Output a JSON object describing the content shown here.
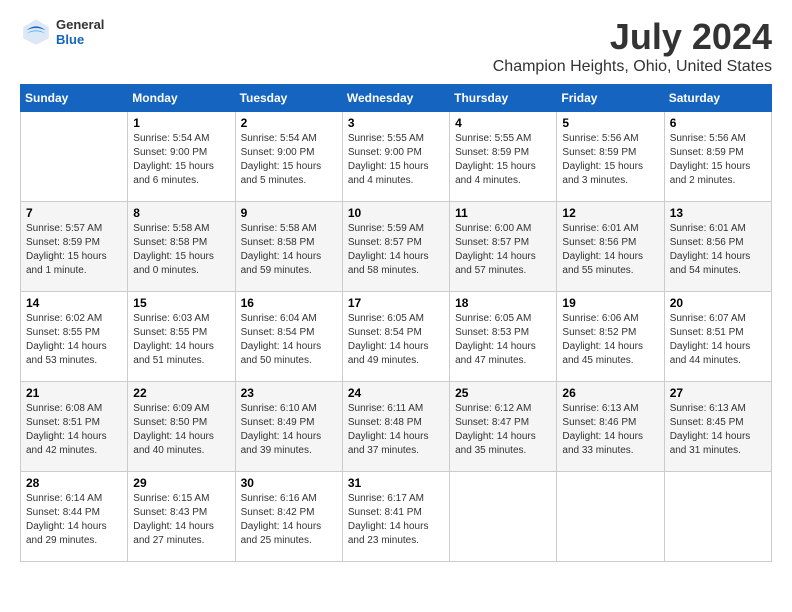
{
  "header": {
    "logo": {
      "line1": "General",
      "line2": "Blue"
    },
    "title": "July 2024",
    "subtitle": "Champion Heights, Ohio, United States"
  },
  "calendar": {
    "days_of_week": [
      "Sunday",
      "Monday",
      "Tuesday",
      "Wednesday",
      "Thursday",
      "Friday",
      "Saturday"
    ],
    "weeks": [
      [
        {
          "day": "",
          "sunrise": "",
          "sunset": "",
          "daylight": "",
          "empty": true
        },
        {
          "day": "1",
          "sunrise": "Sunrise: 5:54 AM",
          "sunset": "Sunset: 9:00 PM",
          "daylight": "Daylight: 15 hours and 6 minutes.",
          "empty": false
        },
        {
          "day": "2",
          "sunrise": "Sunrise: 5:54 AM",
          "sunset": "Sunset: 9:00 PM",
          "daylight": "Daylight: 15 hours and 5 minutes.",
          "empty": false
        },
        {
          "day": "3",
          "sunrise": "Sunrise: 5:55 AM",
          "sunset": "Sunset: 9:00 PM",
          "daylight": "Daylight: 15 hours and 4 minutes.",
          "empty": false
        },
        {
          "day": "4",
          "sunrise": "Sunrise: 5:55 AM",
          "sunset": "Sunset: 8:59 PM",
          "daylight": "Daylight: 15 hours and 4 minutes.",
          "empty": false
        },
        {
          "day": "5",
          "sunrise": "Sunrise: 5:56 AM",
          "sunset": "Sunset: 8:59 PM",
          "daylight": "Daylight: 15 hours and 3 minutes.",
          "empty": false
        },
        {
          "day": "6",
          "sunrise": "Sunrise: 5:56 AM",
          "sunset": "Sunset: 8:59 PM",
          "daylight": "Daylight: 15 hours and 2 minutes.",
          "empty": false
        }
      ],
      [
        {
          "day": "7",
          "sunrise": "Sunrise: 5:57 AM",
          "sunset": "Sunset: 8:59 PM",
          "daylight": "Daylight: 15 hours and 1 minute.",
          "empty": false
        },
        {
          "day": "8",
          "sunrise": "Sunrise: 5:58 AM",
          "sunset": "Sunset: 8:58 PM",
          "daylight": "Daylight: 15 hours and 0 minutes.",
          "empty": false
        },
        {
          "day": "9",
          "sunrise": "Sunrise: 5:58 AM",
          "sunset": "Sunset: 8:58 PM",
          "daylight": "Daylight: 14 hours and 59 minutes.",
          "empty": false
        },
        {
          "day": "10",
          "sunrise": "Sunrise: 5:59 AM",
          "sunset": "Sunset: 8:57 PM",
          "daylight": "Daylight: 14 hours and 58 minutes.",
          "empty": false
        },
        {
          "day": "11",
          "sunrise": "Sunrise: 6:00 AM",
          "sunset": "Sunset: 8:57 PM",
          "daylight": "Daylight: 14 hours and 57 minutes.",
          "empty": false
        },
        {
          "day": "12",
          "sunrise": "Sunrise: 6:01 AM",
          "sunset": "Sunset: 8:56 PM",
          "daylight": "Daylight: 14 hours and 55 minutes.",
          "empty": false
        },
        {
          "day": "13",
          "sunrise": "Sunrise: 6:01 AM",
          "sunset": "Sunset: 8:56 PM",
          "daylight": "Daylight: 14 hours and 54 minutes.",
          "empty": false
        }
      ],
      [
        {
          "day": "14",
          "sunrise": "Sunrise: 6:02 AM",
          "sunset": "Sunset: 8:55 PM",
          "daylight": "Daylight: 14 hours and 53 minutes.",
          "empty": false
        },
        {
          "day": "15",
          "sunrise": "Sunrise: 6:03 AM",
          "sunset": "Sunset: 8:55 PM",
          "daylight": "Daylight: 14 hours and 51 minutes.",
          "empty": false
        },
        {
          "day": "16",
          "sunrise": "Sunrise: 6:04 AM",
          "sunset": "Sunset: 8:54 PM",
          "daylight": "Daylight: 14 hours and 50 minutes.",
          "empty": false
        },
        {
          "day": "17",
          "sunrise": "Sunrise: 6:05 AM",
          "sunset": "Sunset: 8:54 PM",
          "daylight": "Daylight: 14 hours and 49 minutes.",
          "empty": false
        },
        {
          "day": "18",
          "sunrise": "Sunrise: 6:05 AM",
          "sunset": "Sunset: 8:53 PM",
          "daylight": "Daylight: 14 hours and 47 minutes.",
          "empty": false
        },
        {
          "day": "19",
          "sunrise": "Sunrise: 6:06 AM",
          "sunset": "Sunset: 8:52 PM",
          "daylight": "Daylight: 14 hours and 45 minutes.",
          "empty": false
        },
        {
          "day": "20",
          "sunrise": "Sunrise: 6:07 AM",
          "sunset": "Sunset: 8:51 PM",
          "daylight": "Daylight: 14 hours and 44 minutes.",
          "empty": false
        }
      ],
      [
        {
          "day": "21",
          "sunrise": "Sunrise: 6:08 AM",
          "sunset": "Sunset: 8:51 PM",
          "daylight": "Daylight: 14 hours and 42 minutes.",
          "empty": false
        },
        {
          "day": "22",
          "sunrise": "Sunrise: 6:09 AM",
          "sunset": "Sunset: 8:50 PM",
          "daylight": "Daylight: 14 hours and 40 minutes.",
          "empty": false
        },
        {
          "day": "23",
          "sunrise": "Sunrise: 6:10 AM",
          "sunset": "Sunset: 8:49 PM",
          "daylight": "Daylight: 14 hours and 39 minutes.",
          "empty": false
        },
        {
          "day": "24",
          "sunrise": "Sunrise: 6:11 AM",
          "sunset": "Sunset: 8:48 PM",
          "daylight": "Daylight: 14 hours and 37 minutes.",
          "empty": false
        },
        {
          "day": "25",
          "sunrise": "Sunrise: 6:12 AM",
          "sunset": "Sunset: 8:47 PM",
          "daylight": "Daylight: 14 hours and 35 minutes.",
          "empty": false
        },
        {
          "day": "26",
          "sunrise": "Sunrise: 6:13 AM",
          "sunset": "Sunset: 8:46 PM",
          "daylight": "Daylight: 14 hours and 33 minutes.",
          "empty": false
        },
        {
          "day": "27",
          "sunrise": "Sunrise: 6:13 AM",
          "sunset": "Sunset: 8:45 PM",
          "daylight": "Daylight: 14 hours and 31 minutes.",
          "empty": false
        }
      ],
      [
        {
          "day": "28",
          "sunrise": "Sunrise: 6:14 AM",
          "sunset": "Sunset: 8:44 PM",
          "daylight": "Daylight: 14 hours and 29 minutes.",
          "empty": false
        },
        {
          "day": "29",
          "sunrise": "Sunrise: 6:15 AM",
          "sunset": "Sunset: 8:43 PM",
          "daylight": "Daylight: 14 hours and 27 minutes.",
          "empty": false
        },
        {
          "day": "30",
          "sunrise": "Sunrise: 6:16 AM",
          "sunset": "Sunset: 8:42 PM",
          "daylight": "Daylight: 14 hours and 25 minutes.",
          "empty": false
        },
        {
          "day": "31",
          "sunrise": "Sunrise: 6:17 AM",
          "sunset": "Sunset: 8:41 PM",
          "daylight": "Daylight: 14 hours and 23 minutes.",
          "empty": false
        },
        {
          "day": "",
          "sunrise": "",
          "sunset": "",
          "daylight": "",
          "empty": true
        },
        {
          "day": "",
          "sunrise": "",
          "sunset": "",
          "daylight": "",
          "empty": true
        },
        {
          "day": "",
          "sunrise": "",
          "sunset": "",
          "daylight": "",
          "empty": true
        }
      ]
    ]
  }
}
